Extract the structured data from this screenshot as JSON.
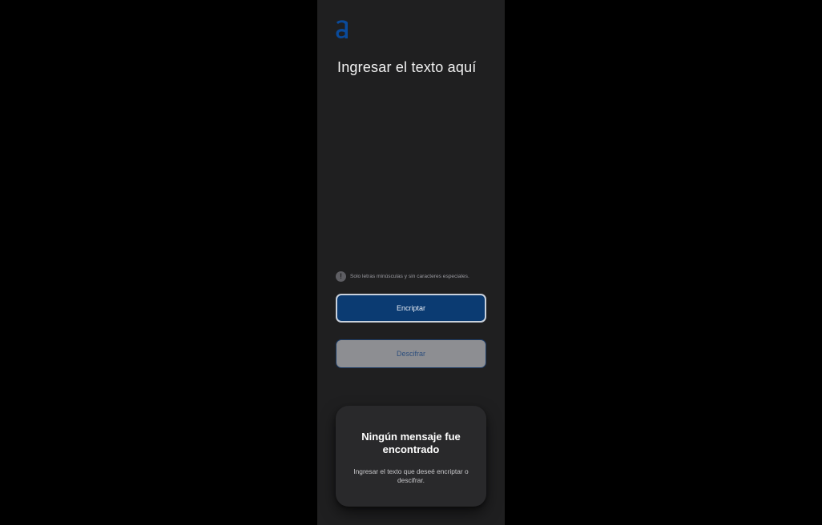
{
  "app": {
    "logo_glyph": "a",
    "accent_color": "#0a3e7a"
  },
  "input": {
    "placeholder": "Ingresar el texto aquí",
    "value": ""
  },
  "hint": {
    "icon": "exclamation-icon",
    "icon_glyph": "!",
    "text": "Solo letras minúsculas y sin caracteres especiales."
  },
  "buttons": {
    "encrypt_label": "Encriptar",
    "decrypt_label": "Descifrar"
  },
  "output": {
    "title": "Ningún mensaje fue encontrado",
    "body": "Ingresar el texto que deseé encriptar o descifrar."
  }
}
